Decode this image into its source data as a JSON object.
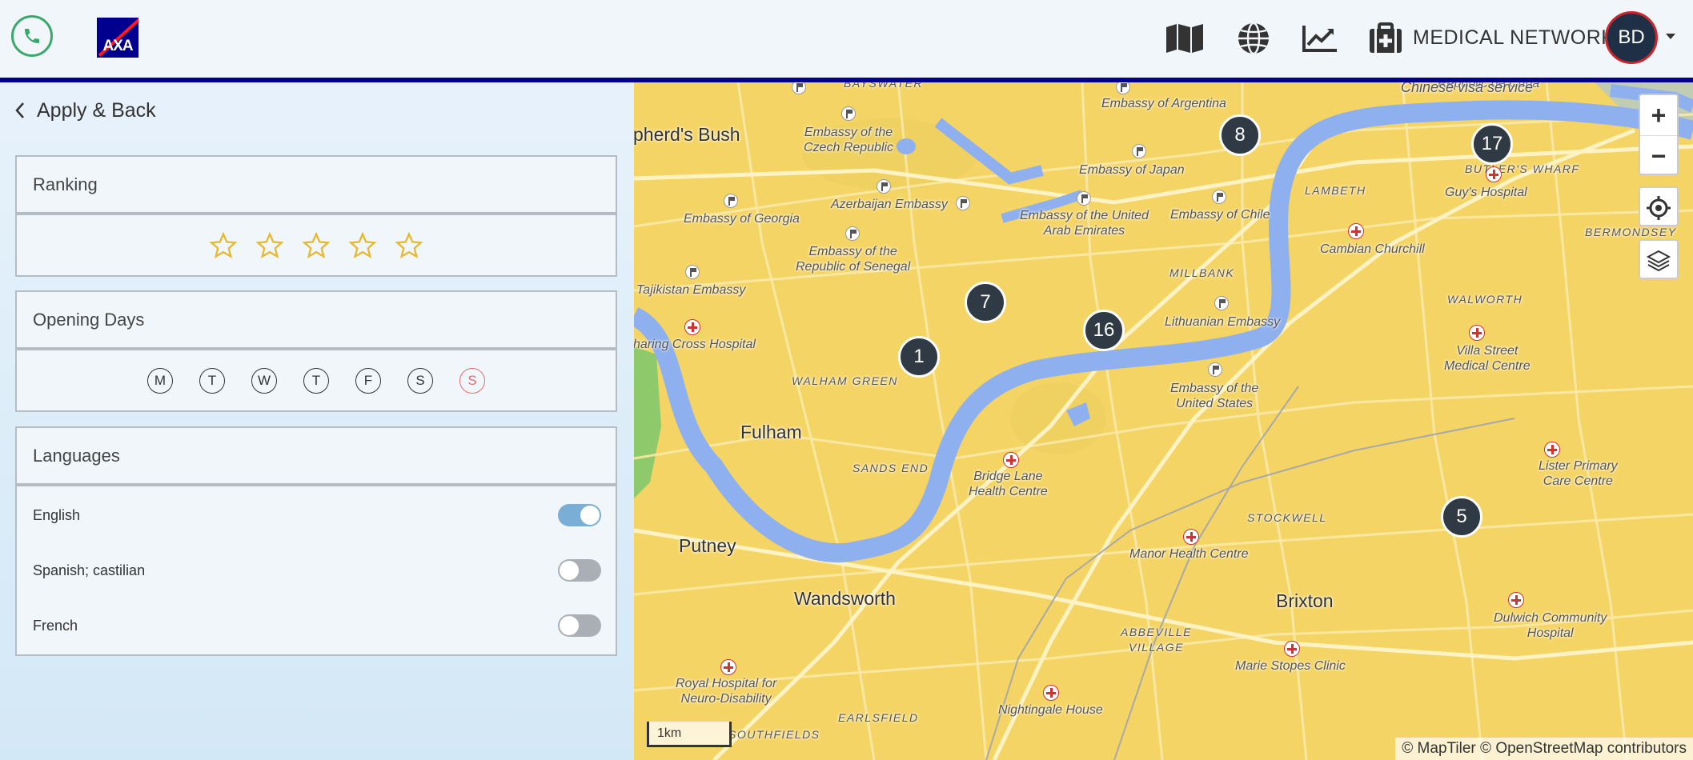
{
  "header": {
    "network_label": "MEDICAL NETWORK",
    "avatar_initials": "BD",
    "logo_text": "AXA",
    "icons": [
      "phone-icon",
      "map-icon",
      "globe-icon",
      "trend-chart-icon",
      "medical-kit-icon",
      "chevron-down-icon"
    ],
    "colors": {
      "brand": "#00008f",
      "phone": "#3aa86a",
      "avatar_ring": "#c8282d"
    }
  },
  "sidebar": {
    "back_label": "Apply & Back",
    "ranking": {
      "title": "Ranking",
      "stars_selected": 0,
      "stars_total": 5
    },
    "opening_days": {
      "title": "Opening Days",
      "days": [
        "M",
        "T",
        "W",
        "T",
        "F",
        "S",
        "S"
      ]
    },
    "languages": {
      "title": "Languages",
      "items": [
        {
          "label": "English",
          "enabled": true
        },
        {
          "label": "Spanish; castilian",
          "enabled": false
        },
        {
          "label": "French",
          "enabled": false
        }
      ]
    }
  },
  "map": {
    "clusters": [
      "8",
      "17",
      "7",
      "16",
      "1",
      "5"
    ],
    "places": {
      "bayswater": "BAYSWATER",
      "republic_cuba": "Republic de Cuba",
      "chinese_visa": "Chinese visa service",
      "shepherds_bush": "pherd's Bush",
      "emb_argentina": "Embassy of Argentina",
      "emb_czech": "Embassy of the\nCzech Republic",
      "emb_japan": "Embassy of Japan",
      "azerbaijan": "Azerbaijan Embassy",
      "emb_georgia": "Embassy of Georgia",
      "emb_uae": "Embassy of the United\nArab Emirates",
      "emb_chile": "Embassy of Chile",
      "lambeth": "LAMBETH",
      "butlers_wharf": "BUTLER'S WHARF",
      "guys": "Guy's Hospital",
      "bermondsey": "BERMONDSEY",
      "cambian": "Cambian Churchill",
      "emb_senegal": "Embassy of the\nRepublic of Senegal",
      "tajikistan": "Tajikistan Embassy",
      "millbank": "MILLBANK",
      "walworth": "WALWORTH",
      "lithuanian": "Lithuanian Embassy",
      "charing_cross": "haring Cross Hospital",
      "villa_street": "Villa Street\nMedical Centre",
      "walham_green": "WALHAM GREEN",
      "emb_us": "Embassy of the\nUnited States",
      "fulham": "Fulham",
      "sands_end": "SANDS END",
      "bridge_lane": "Bridge Lane\nHealth Centre",
      "lister": "Lister Primary\nCare Centre",
      "stockwell": "STOCKWELL",
      "putney": "Putney",
      "manor": "Manor Health Centre",
      "wandsworth": "Wandsworth",
      "brixton": "Brixton",
      "dulwich": "Dulwich Community\nHospital",
      "abbeville": "ABBEVILLE\nVILLAGE",
      "marie_stopes": "Marie Stopes Clinic",
      "royal_hospital": "Royal Hospital for\nNeuro-Disability",
      "nightingale": "Nightingale House",
      "earlsfield": "EARLSFIELD",
      "southfields": "SOUTHFIELDS"
    },
    "scale_label": "1km",
    "attribution": "© MapTiler © OpenStreetMap contributors",
    "controls": {
      "zoom_in": "+",
      "zoom_out": "−"
    },
    "colors": {
      "land": "#f5d466",
      "water": "#8fb0ee",
      "park": "#8ec96b",
      "cluster": "#2f3a45"
    }
  }
}
